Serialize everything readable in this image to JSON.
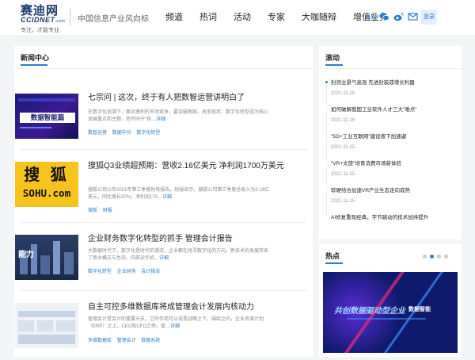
{
  "header": {
    "logo_cn": "赛迪网",
    "logo_en": "CCIDNET",
    "logo_suffix": ".com",
    "logo_tag": "专注，才能专业",
    "slogan": "中国信息产业风向标",
    "nav": [
      "频道",
      "热词",
      "活动",
      "专家",
      "大咖随辩",
      "增值业务"
    ],
    "lang": "EN",
    "login": "登录"
  },
  "news": {
    "title": "新闻中心",
    "articles": [
      {
        "title": "七宗问 | 这次，终于有人把数智运营讲明白了",
        "summary": "在数字化浪潮下，面对激烈的市场竞争，要突破困局，改变现状，数字化转型成为核心发展重点和主题，而不同于\"技…",
        "more": "详细",
        "tags": [
          "数智运营",
          "数据中台",
          "数字化转型"
        ],
        "thumb_label": "数据智能篇"
      },
      {
        "title": "搜狐Q3业绩超预期：营收2.16亿美元 净利润1700万美元",
        "summary": "搜狐公司公布2021年第三季度财务报告。财报显示，搜狐公司第三季度总收入为2.16亿美元，同比增长37%；净利润170…",
        "more": "详细",
        "tags": [
          "搜狐",
          "财报"
        ],
        "thumb_label_top": "搜 狐",
        "thumb_label_bottom": "SOHU.com"
      },
      {
        "title": "企业财务数字化转型的抓手 管理会计报告",
        "summary": "大数据时代下，数字化是时代的潮流，企业都在找寻数字化的方向。新技术的发展带来了商业模式与生态、内部运作机…",
        "more": "详细",
        "tags": [
          "数字化转型",
          "企业财务",
          "会计报告"
        ],
        "thumb_label": "能力"
      },
      {
        "title": "自主可控多维数据库将成管理会计发展内核动力",
        "summary": "管理会计是会计的重要分支，它的作用可以说是战略之下，围绕之内，企业资源计划（ERP）之上，CEO和CFO之旁。管…",
        "more": "详细",
        "tags": [
          "多维数据库",
          "管理会计",
          "数据系统"
        ]
      }
    ]
  },
  "flash": {
    "title": "滚动",
    "items": [
      {
        "title": "封测业景气高涨 先进封装成增长利器",
        "date": "2021-11-16"
      },
      {
        "title": "如何破解我国工业软件人才三大\"难点\"",
        "date": "2021-11-16"
      },
      {
        "title": "\"5G+工业互联网\"建设按下加速键",
        "date": "2021-11-15"
      },
      {
        "title": "\"VR+文旅\"培育消费市场新体验",
        "date": "2021-11-15"
      },
      {
        "title": "软硬结合加速VR产业生态走向成熟",
        "date": "2021-11-15"
      },
      {
        "title": "AI修复重现经典，字节跳动的技术加持提升",
        "date": ""
      }
    ]
  },
  "hot": {
    "title": "热点",
    "banner_text": "共创数据驱动型企业",
    "banner_sub": "数据智能"
  },
  "colors": {
    "accent": "#2a7ecf",
    "brand": "#1d3b6e"
  }
}
